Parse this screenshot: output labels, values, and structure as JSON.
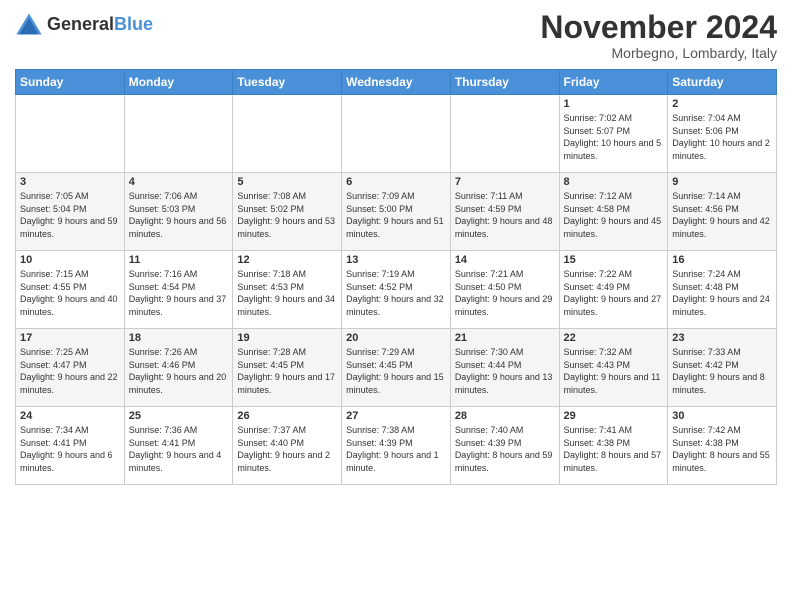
{
  "logo": {
    "general": "General",
    "blue": "Blue"
  },
  "title": "November 2024",
  "subtitle": "Morbegno, Lombardy, Italy",
  "days_header": [
    "Sunday",
    "Monday",
    "Tuesday",
    "Wednesday",
    "Thursday",
    "Friday",
    "Saturday"
  ],
  "weeks": [
    [
      {
        "day": "",
        "sunrise": "",
        "sunset": "",
        "daylight": ""
      },
      {
        "day": "",
        "sunrise": "",
        "sunset": "",
        "daylight": ""
      },
      {
        "day": "",
        "sunrise": "",
        "sunset": "",
        "daylight": ""
      },
      {
        "day": "",
        "sunrise": "",
        "sunset": "",
        "daylight": ""
      },
      {
        "day": "",
        "sunrise": "",
        "sunset": "",
        "daylight": ""
      },
      {
        "day": "1",
        "sunrise": "Sunrise: 7:02 AM",
        "sunset": "Sunset: 5:07 PM",
        "daylight": "Daylight: 10 hours and 5 minutes."
      },
      {
        "day": "2",
        "sunrise": "Sunrise: 7:04 AM",
        "sunset": "Sunset: 5:06 PM",
        "daylight": "Daylight: 10 hours and 2 minutes."
      }
    ],
    [
      {
        "day": "3",
        "sunrise": "Sunrise: 7:05 AM",
        "sunset": "Sunset: 5:04 PM",
        "daylight": "Daylight: 9 hours and 59 minutes."
      },
      {
        "day": "4",
        "sunrise": "Sunrise: 7:06 AM",
        "sunset": "Sunset: 5:03 PM",
        "daylight": "Daylight: 9 hours and 56 minutes."
      },
      {
        "day": "5",
        "sunrise": "Sunrise: 7:08 AM",
        "sunset": "Sunset: 5:02 PM",
        "daylight": "Daylight: 9 hours and 53 minutes."
      },
      {
        "day": "6",
        "sunrise": "Sunrise: 7:09 AM",
        "sunset": "Sunset: 5:00 PM",
        "daylight": "Daylight: 9 hours and 51 minutes."
      },
      {
        "day": "7",
        "sunrise": "Sunrise: 7:11 AM",
        "sunset": "Sunset: 4:59 PM",
        "daylight": "Daylight: 9 hours and 48 minutes."
      },
      {
        "day": "8",
        "sunrise": "Sunrise: 7:12 AM",
        "sunset": "Sunset: 4:58 PM",
        "daylight": "Daylight: 9 hours and 45 minutes."
      },
      {
        "day": "9",
        "sunrise": "Sunrise: 7:14 AM",
        "sunset": "Sunset: 4:56 PM",
        "daylight": "Daylight: 9 hours and 42 minutes."
      }
    ],
    [
      {
        "day": "10",
        "sunrise": "Sunrise: 7:15 AM",
        "sunset": "Sunset: 4:55 PM",
        "daylight": "Daylight: 9 hours and 40 minutes."
      },
      {
        "day": "11",
        "sunrise": "Sunrise: 7:16 AM",
        "sunset": "Sunset: 4:54 PM",
        "daylight": "Daylight: 9 hours and 37 minutes."
      },
      {
        "day": "12",
        "sunrise": "Sunrise: 7:18 AM",
        "sunset": "Sunset: 4:53 PM",
        "daylight": "Daylight: 9 hours and 34 minutes."
      },
      {
        "day": "13",
        "sunrise": "Sunrise: 7:19 AM",
        "sunset": "Sunset: 4:52 PM",
        "daylight": "Daylight: 9 hours and 32 minutes."
      },
      {
        "day": "14",
        "sunrise": "Sunrise: 7:21 AM",
        "sunset": "Sunset: 4:50 PM",
        "daylight": "Daylight: 9 hours and 29 minutes."
      },
      {
        "day": "15",
        "sunrise": "Sunrise: 7:22 AM",
        "sunset": "Sunset: 4:49 PM",
        "daylight": "Daylight: 9 hours and 27 minutes."
      },
      {
        "day": "16",
        "sunrise": "Sunrise: 7:24 AM",
        "sunset": "Sunset: 4:48 PM",
        "daylight": "Daylight: 9 hours and 24 minutes."
      }
    ],
    [
      {
        "day": "17",
        "sunrise": "Sunrise: 7:25 AM",
        "sunset": "Sunset: 4:47 PM",
        "daylight": "Daylight: 9 hours and 22 minutes."
      },
      {
        "day": "18",
        "sunrise": "Sunrise: 7:26 AM",
        "sunset": "Sunset: 4:46 PM",
        "daylight": "Daylight: 9 hours and 20 minutes."
      },
      {
        "day": "19",
        "sunrise": "Sunrise: 7:28 AM",
        "sunset": "Sunset: 4:45 PM",
        "daylight": "Daylight: 9 hours and 17 minutes."
      },
      {
        "day": "20",
        "sunrise": "Sunrise: 7:29 AM",
        "sunset": "Sunset: 4:45 PM",
        "daylight": "Daylight: 9 hours and 15 minutes."
      },
      {
        "day": "21",
        "sunrise": "Sunrise: 7:30 AM",
        "sunset": "Sunset: 4:44 PM",
        "daylight": "Daylight: 9 hours and 13 minutes."
      },
      {
        "day": "22",
        "sunrise": "Sunrise: 7:32 AM",
        "sunset": "Sunset: 4:43 PM",
        "daylight": "Daylight: 9 hours and 11 minutes."
      },
      {
        "day": "23",
        "sunrise": "Sunrise: 7:33 AM",
        "sunset": "Sunset: 4:42 PM",
        "daylight": "Daylight: 9 hours and 8 minutes."
      }
    ],
    [
      {
        "day": "24",
        "sunrise": "Sunrise: 7:34 AM",
        "sunset": "Sunset: 4:41 PM",
        "daylight": "Daylight: 9 hours and 6 minutes."
      },
      {
        "day": "25",
        "sunrise": "Sunrise: 7:36 AM",
        "sunset": "Sunset: 4:41 PM",
        "daylight": "Daylight: 9 hours and 4 minutes."
      },
      {
        "day": "26",
        "sunrise": "Sunrise: 7:37 AM",
        "sunset": "Sunset: 4:40 PM",
        "daylight": "Daylight: 9 hours and 2 minutes."
      },
      {
        "day": "27",
        "sunrise": "Sunrise: 7:38 AM",
        "sunset": "Sunset: 4:39 PM",
        "daylight": "Daylight: 9 hours and 1 minute."
      },
      {
        "day": "28",
        "sunrise": "Sunrise: 7:40 AM",
        "sunset": "Sunset: 4:39 PM",
        "daylight": "Daylight: 8 hours and 59 minutes."
      },
      {
        "day": "29",
        "sunrise": "Sunrise: 7:41 AM",
        "sunset": "Sunset: 4:38 PM",
        "daylight": "Daylight: 8 hours and 57 minutes."
      },
      {
        "day": "30",
        "sunrise": "Sunrise: 7:42 AM",
        "sunset": "Sunset: 4:38 PM",
        "daylight": "Daylight: 8 hours and 55 minutes."
      }
    ]
  ]
}
